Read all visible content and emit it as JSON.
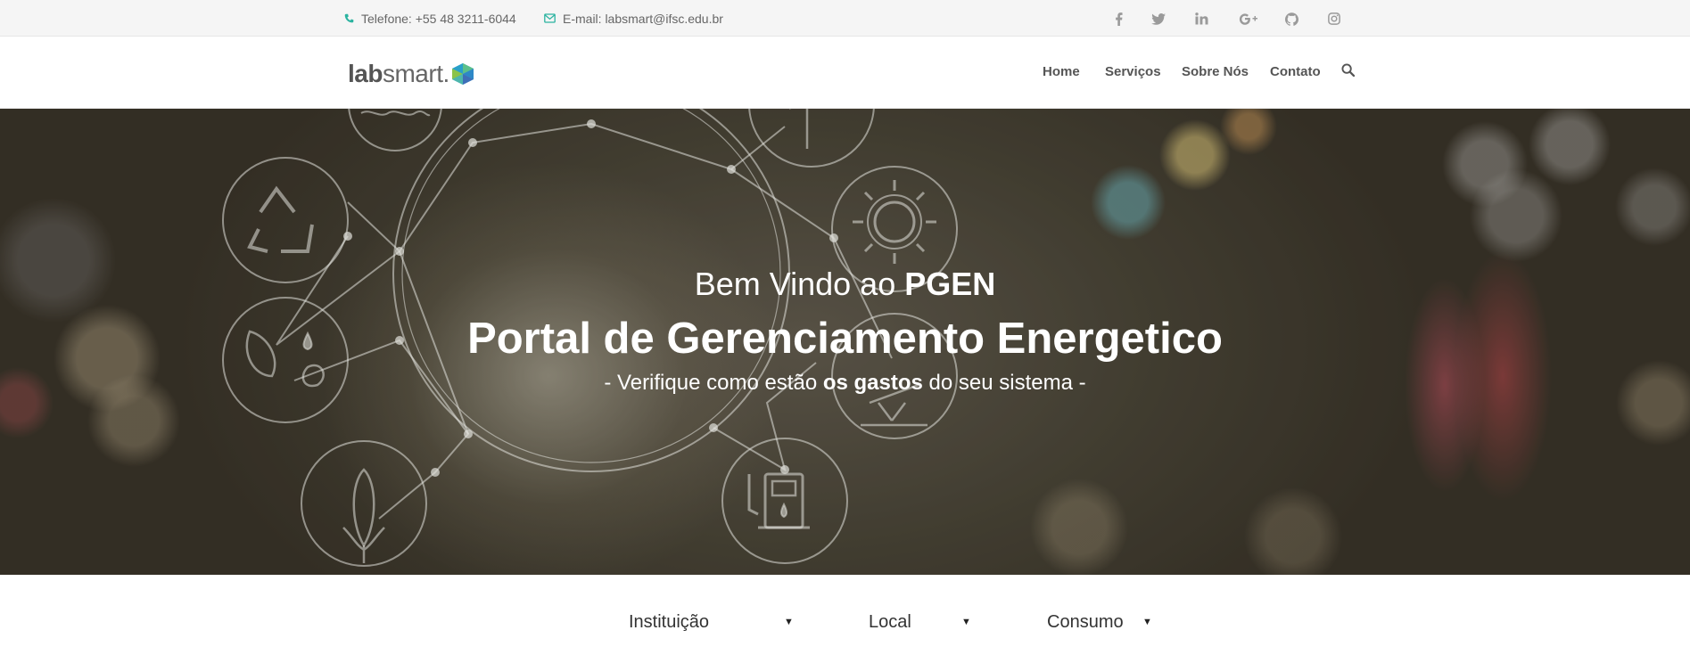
{
  "topbar": {
    "phone": "Telefone: +55 48 3211-6044",
    "email": "E-mail: labsmart@ifsc.edu.br",
    "social": [
      {
        "icon": "facebook-icon",
        "glyph": "f"
      },
      {
        "icon": "twitter-icon",
        "glyph": "t"
      },
      {
        "icon": "linkedin-icon",
        "glyph": "in"
      },
      {
        "icon": "google-plus-icon",
        "glyph": "G+"
      },
      {
        "icon": "github-icon",
        "glyph": "gh"
      },
      {
        "icon": "instagram-icon",
        "glyph": "ig"
      }
    ]
  },
  "logo": {
    "lab": "lab",
    "smart": "smart."
  },
  "nav": {
    "home": "Home",
    "services": "Serviços",
    "about": "Sobre Nós",
    "contact": "Contato"
  },
  "hero": {
    "welcome_prefix": "Bem Vindo ao ",
    "welcome_brand": "PGEN",
    "title": "Portal de Gerenciamento Energetico",
    "subtitle_prefix": "- Verifique como estão ",
    "subtitle_bold": "os gastos",
    "subtitle_suffix": " do seu sistema -"
  },
  "filters": {
    "institution": "Instituição",
    "location": "Local",
    "consumption": "Consumo",
    "arrow": "▼"
  },
  "colors": {
    "accent": "#2bb3a0",
    "topbar_bg": "#f5f5f5",
    "nav_text": "#555555"
  }
}
